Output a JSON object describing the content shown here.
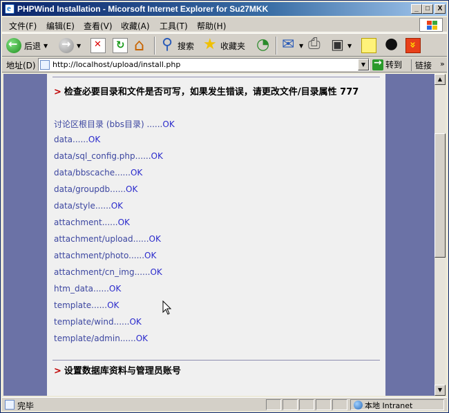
{
  "window": {
    "title": "PHPWind Installation - Micorsoft Internet Explorer for Su27MKK",
    "min_label": "_",
    "max_label": "□",
    "close_label": "X"
  },
  "menu": [
    "文件(F)",
    "编辑(E)",
    "查看(V)",
    "收藏(A)",
    "工具(T)",
    "帮助(H)"
  ],
  "toolbar": {
    "back_label": "后退",
    "search_label": "搜索",
    "favorites_label": "收藏夹"
  },
  "address": {
    "label": "地址(D)",
    "url": "http://localhost/upload/install.php",
    "go_label": "转到",
    "links_label": "链接"
  },
  "content": {
    "section1_title": "检查必要目录和文件是否可写，如果发生错误，请更改文件/目录属性 777",
    "arrow": ">",
    "items": [
      {
        "path": "讨论区根目录 (bbs目录) ......",
        "status": "OK"
      },
      {
        "path": "data......",
        "status": "OK"
      },
      {
        "path": "data/sql_config.php......",
        "status": "OK"
      },
      {
        "path": "data/bbscache......",
        "status": "OK"
      },
      {
        "path": "data/groupdb......",
        "status": "OK"
      },
      {
        "path": "data/style......",
        "status": "OK"
      },
      {
        "path": "attachment......",
        "status": "OK"
      },
      {
        "path": "attachment/upload......",
        "status": "OK"
      },
      {
        "path": "attachment/photo......",
        "status": "OK"
      },
      {
        "path": "attachment/cn_img......",
        "status": "OK"
      },
      {
        "path": "htm_data......",
        "status": "OK"
      },
      {
        "path": "template......",
        "status": "OK"
      },
      {
        "path": "template/wind......",
        "status": "OK"
      },
      {
        "path": "template/admin......",
        "status": "OK"
      }
    ],
    "section2_title": "设置数据库资料与管理员账号"
  },
  "status": {
    "text": "完毕",
    "zone": "本地 Intranet"
  },
  "colors": {
    "page_bg": "#6b72a6",
    "panel_bg": "#f0f0f0",
    "link_text": "#3c46a0",
    "ok_text": "#2a2acc",
    "arrow": "#c00000"
  }
}
